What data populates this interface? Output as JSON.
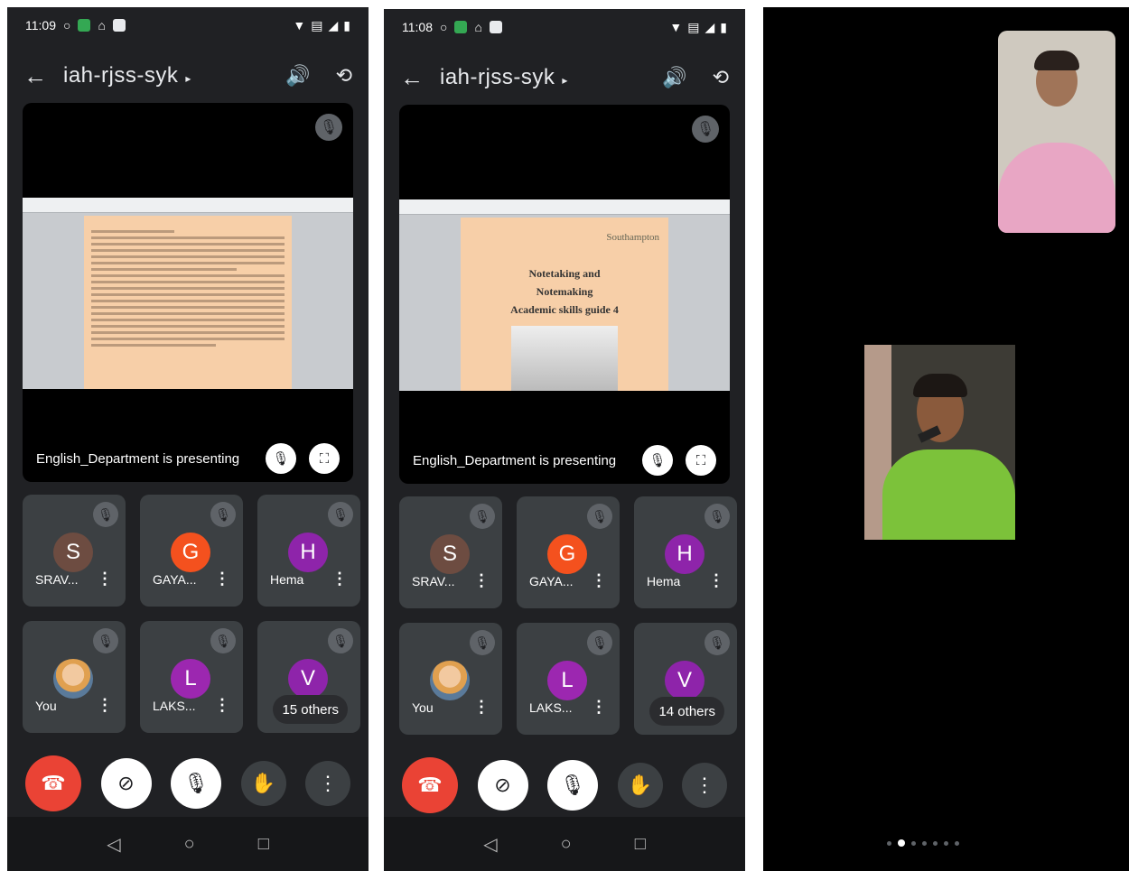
{
  "phones": [
    {
      "status_time": "11:09",
      "meeting_code": "iah-rjss-syk",
      "presenting_text": "English_Department is presenting",
      "participants": [
        {
          "initial": "S",
          "name": "SRAV...",
          "color": "#6d4c41"
        },
        {
          "initial": "G",
          "name": "GAYA...",
          "color": "#f4511e"
        },
        {
          "initial": "H",
          "name": "Hema",
          "color": "#8e24aa"
        },
        {
          "initial": "",
          "name": "You",
          "color": ""
        },
        {
          "initial": "L",
          "name": "LAKS...",
          "color": "#9c27b0"
        },
        {
          "initial": "V",
          "name": "",
          "color": "#8e24aa"
        }
      ],
      "others_label": "15 others"
    },
    {
      "status_time": "11:08",
      "meeting_code": "iah-rjss-syk",
      "presenting_text": "English_Department is presenting",
      "slide": {
        "university": "Southampton",
        "title_lines": [
          "Notetaking and",
          "Notemaking",
          "Academic skills guide 4"
        ]
      },
      "participants": [
        {
          "initial": "S",
          "name": "SRAV...",
          "color": "#6d4c41"
        },
        {
          "initial": "G",
          "name": "GAYA...",
          "color": "#f4511e"
        },
        {
          "initial": "H",
          "name": "Hema",
          "color": "#8e24aa"
        },
        {
          "initial": "",
          "name": "You",
          "color": ""
        },
        {
          "initial": "L",
          "name": "LAKS...",
          "color": "#9c27b0"
        },
        {
          "initial": "V",
          "name": "",
          "color": "#8e24aa"
        }
      ],
      "others_label": "14 others"
    }
  ],
  "icons": {
    "back": "←",
    "caret": "▸",
    "speaker": "🔊",
    "switch_camera": "⟲",
    "mic_off": "🎙",
    "fullscreen": "⛶",
    "end_call": "☎",
    "camera_off": "⊘",
    "hand": "✋",
    "more": "⋮",
    "nav_back": "◁",
    "nav_home": "○",
    "nav_recent": "□"
  },
  "colors": {
    "end_call": "#ea4335",
    "tile_bg": "#3c4043",
    "app_bg": "#202124"
  },
  "pager": {
    "count": 7,
    "active_index": 1
  }
}
